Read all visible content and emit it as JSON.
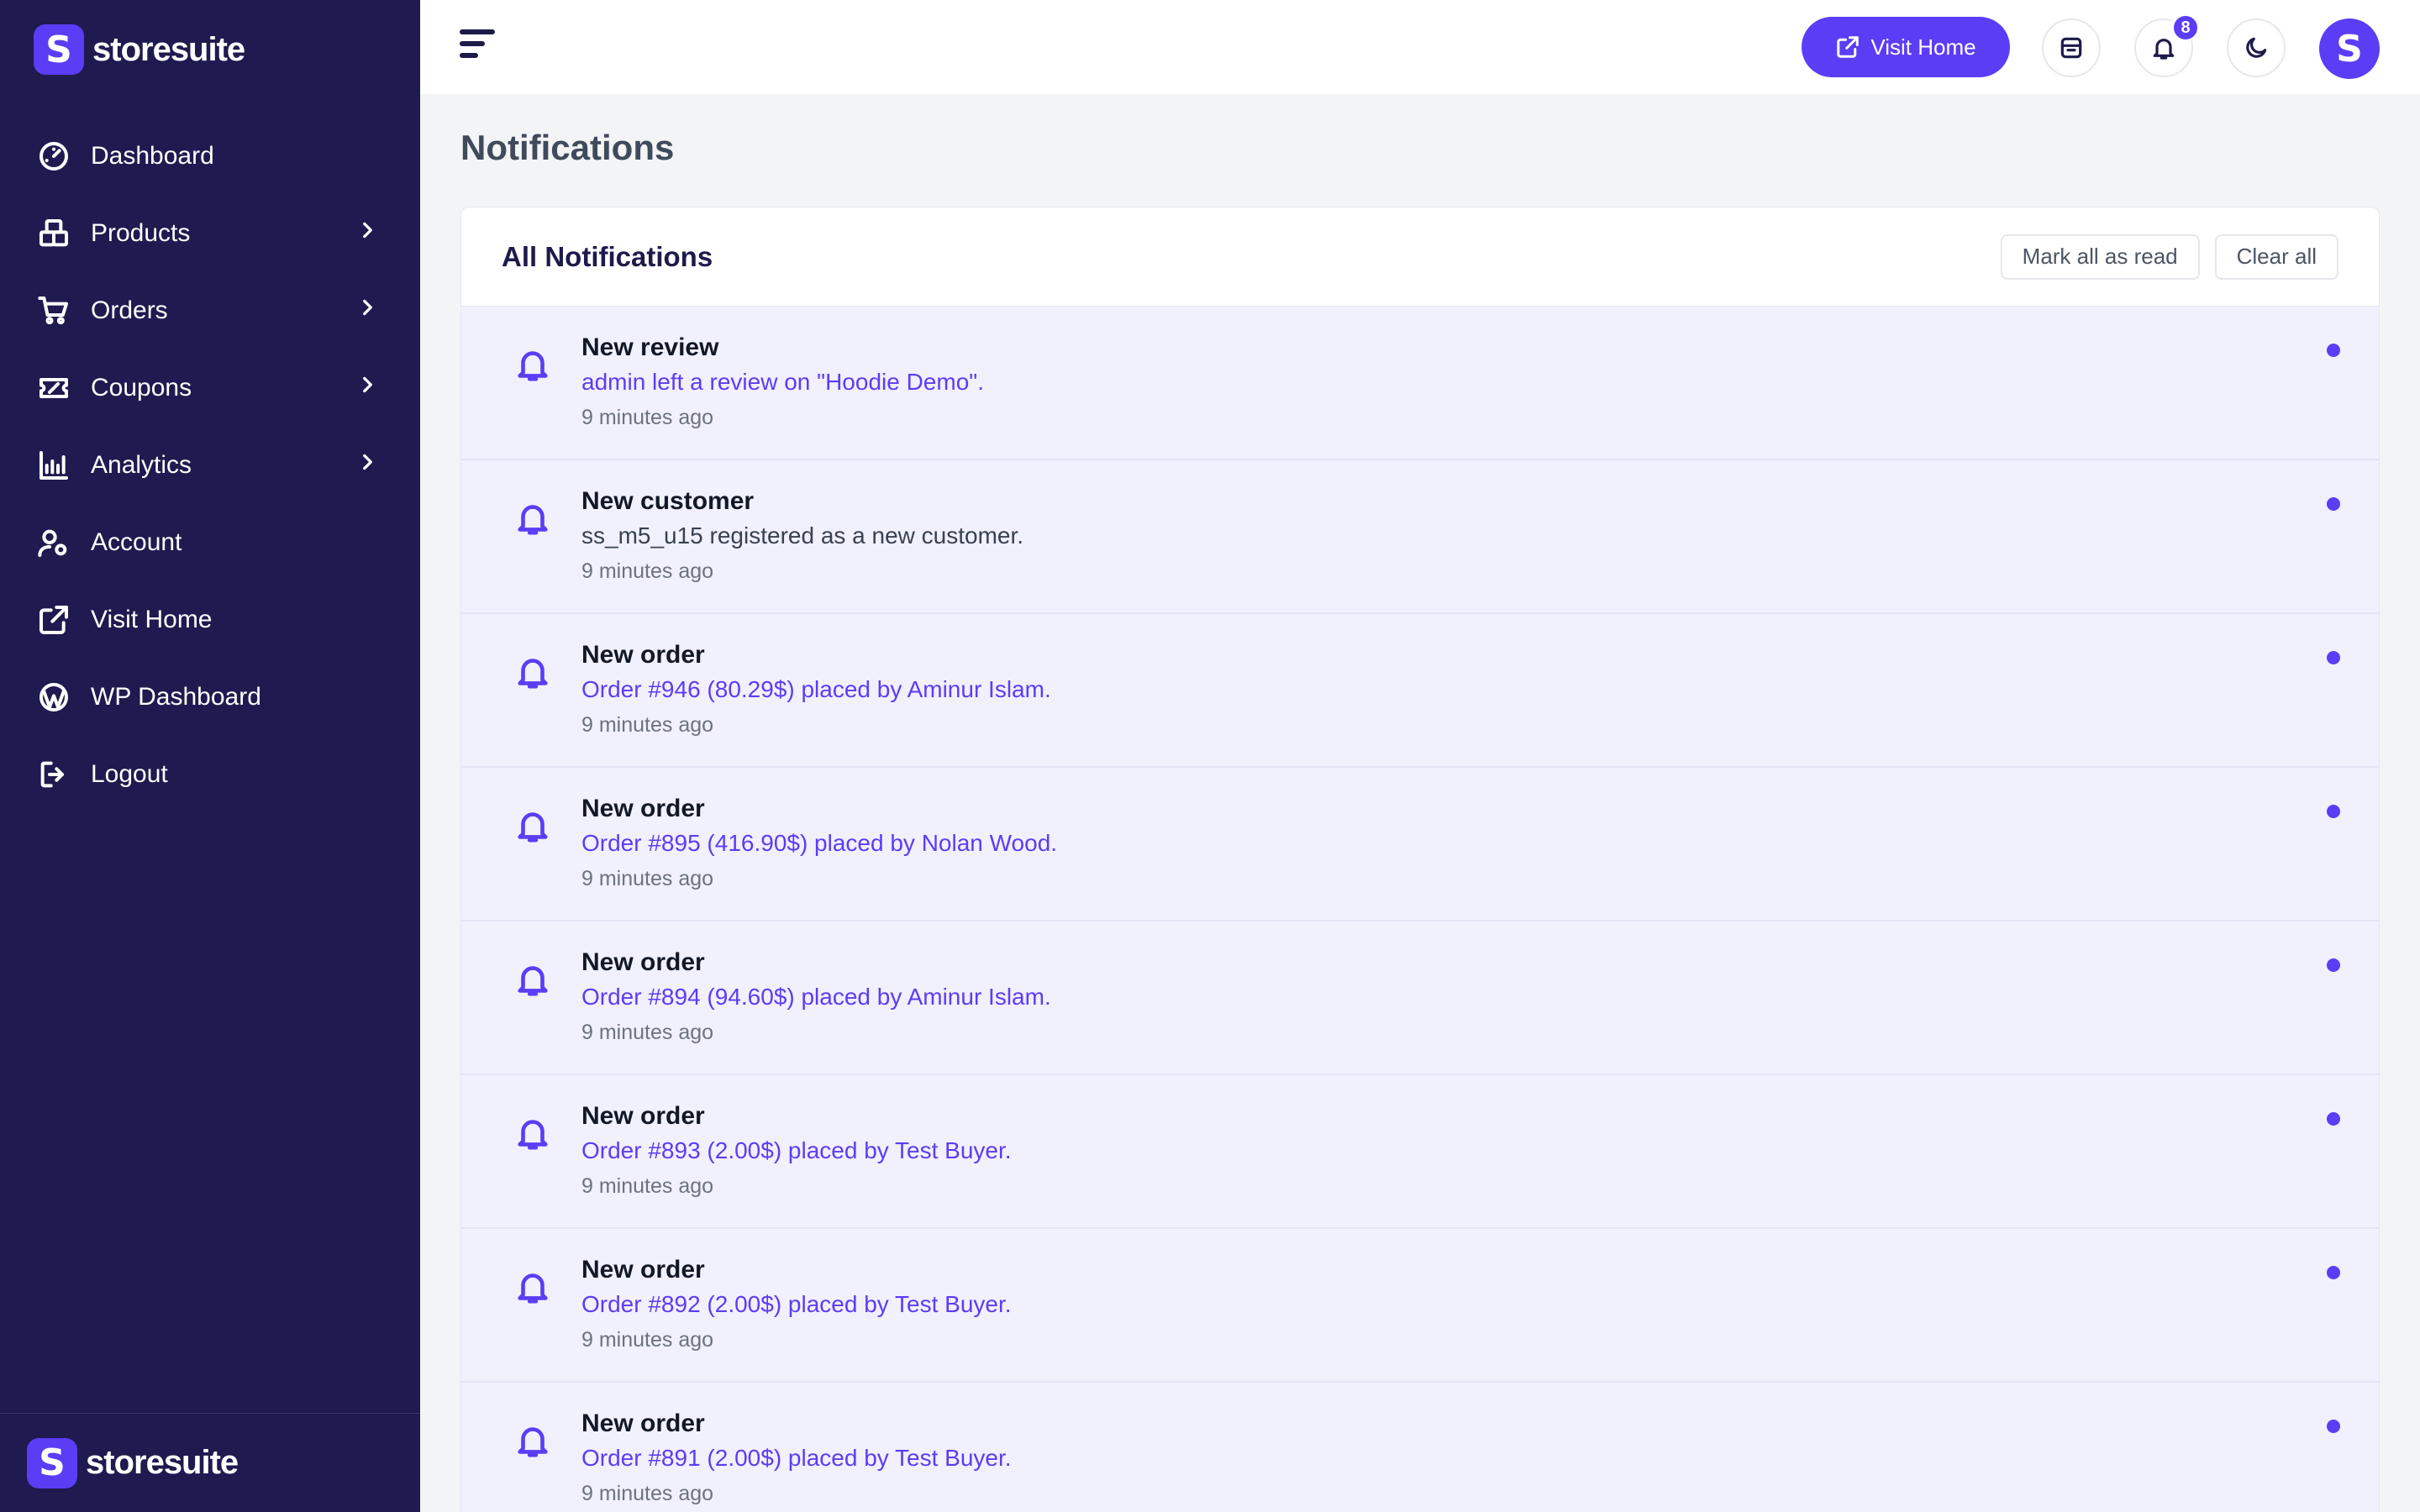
{
  "brand": {
    "name": "storesuite",
    "mark": "S"
  },
  "sidebar": {
    "items": [
      {
        "label": "Dashboard",
        "icon": "gauge-icon",
        "has_submenu": false
      },
      {
        "label": "Products",
        "icon": "boxes-icon",
        "has_submenu": true
      },
      {
        "label": "Orders",
        "icon": "cart-icon",
        "has_submenu": true
      },
      {
        "label": "Coupons",
        "icon": "ticket-icon",
        "has_submenu": true
      },
      {
        "label": "Analytics",
        "icon": "chart-icon",
        "has_submenu": true
      },
      {
        "label": "Account",
        "icon": "user-gear-icon",
        "has_submenu": false
      },
      {
        "label": "Visit Home",
        "icon": "external-link-icon",
        "has_submenu": false
      },
      {
        "label": "WP Dashboard",
        "icon": "wordpress-icon",
        "has_submenu": false
      },
      {
        "label": "Logout",
        "icon": "logout-icon",
        "has_submenu": false
      }
    ]
  },
  "topbar": {
    "visit_home_label": "Visit Home",
    "notification_count": "8",
    "avatar_letter": "S"
  },
  "page": {
    "title": "Notifications"
  },
  "card": {
    "title": "All Notifications",
    "mark_all_label": "Mark all as read",
    "clear_all_label": "Clear all"
  },
  "notifications": [
    {
      "title": "New review",
      "message": "admin left a review on \"Hoodie Demo\".",
      "time": "9 minutes ago",
      "linked": true
    },
    {
      "title": "New customer",
      "message": "ss_m5_u15 registered as a new customer.",
      "time": "9 minutes ago",
      "linked": false
    },
    {
      "title": "New order",
      "message": "Order #946 (80.29$) placed by Aminur Islam.",
      "time": "9 minutes ago",
      "linked": true
    },
    {
      "title": "New order",
      "message": "Order #895 (416.90$) placed by Nolan Wood.",
      "time": "9 minutes ago",
      "linked": true
    },
    {
      "title": "New order",
      "message": "Order #894 (94.60$) placed by Aminur Islam.",
      "time": "9 minutes ago",
      "linked": true
    },
    {
      "title": "New order",
      "message": "Order #893 (2.00$) placed by Test Buyer.",
      "time": "9 minutes ago",
      "linked": true
    },
    {
      "title": "New order",
      "message": "Order #892 (2.00$) placed by Test Buyer.",
      "time": "9 minutes ago",
      "linked": true
    },
    {
      "title": "New order",
      "message": "Order #891 (2.00$) placed by Test Buyer.",
      "time": "9 minutes ago",
      "linked": true
    }
  ],
  "colors": {
    "sidebar_bg": "#1f1a4f",
    "accent": "#5b3df5",
    "unread_bg": "#f1f0fd"
  }
}
